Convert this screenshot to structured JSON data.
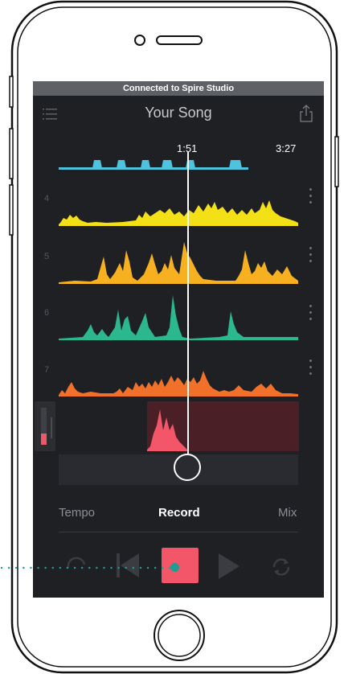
{
  "status_bar": {
    "text": "Connected to Spire Studio"
  },
  "nav": {
    "title": "Your Song"
  },
  "timeline": {
    "playhead_time": "1:51",
    "total_time": "3:27"
  },
  "tracks": [
    {
      "number": "4",
      "color": "#f4e017"
    },
    {
      "number": "5",
      "color": "#f7b020"
    },
    {
      "number": "6",
      "color": "#2cb88f"
    },
    {
      "number": "7",
      "color": "#f2712a"
    }
  ],
  "recording_track": {
    "color": "#f25668",
    "level": 0.3
  },
  "tabs": {
    "tempo": "Tempo",
    "record": "Record",
    "mix": "Mix"
  },
  "transport": {
    "loop_icon": "loop-icon",
    "skip_back_icon": "skip-back-icon",
    "record_icon": "stop-record-icon",
    "play_icon": "play-icon",
    "sync_icon": "sync-icon"
  },
  "colors": {
    "blue_track": "#4ec3e0",
    "accent_teal": "#1e9e92",
    "record": "#f25668"
  }
}
